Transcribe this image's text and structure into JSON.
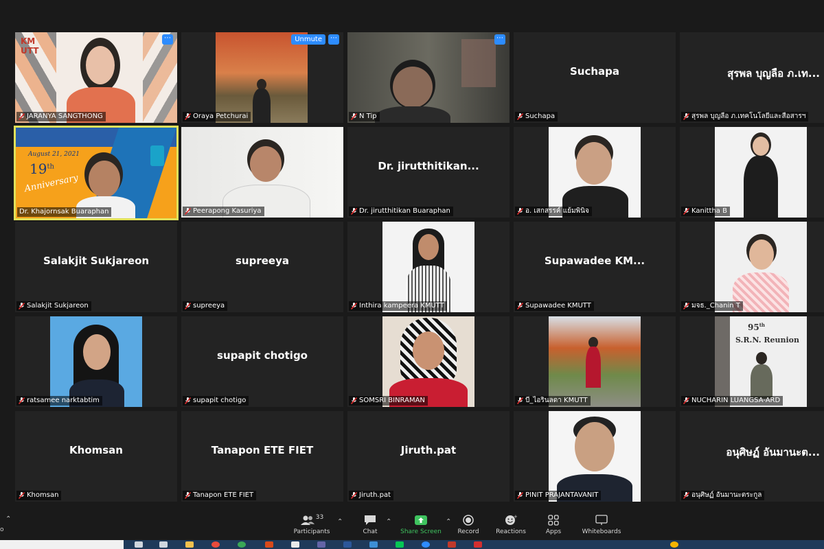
{
  "participants": [
    {
      "name": "JARANYA SANGTHONG",
      "display": "video",
      "has_more_button": true
    },
    {
      "name": "Oraya Petchurai",
      "display": "video",
      "has_more_button": true,
      "unmute_label": "Unmute"
    },
    {
      "name": "N Tip",
      "display": "video",
      "has_more_button": true
    },
    {
      "name": "Suchapa",
      "display": "name",
      "big_name": "Suchapa"
    },
    {
      "name": "สุรพล บุญลือ ภ.เทคโนโลยีและสื่อสารฯ",
      "display": "name",
      "big_name": "สุรพล บุญลือ ภ.เท..."
    },
    {
      "name": "Dr. Khajornsak Buaraphan",
      "display": "video",
      "active": true,
      "banner": {
        "date": "August 21, 2021",
        "title_num": "19",
        "title_suffix": "th",
        "title_word": "Anniversary"
      }
    },
    {
      "name": "Peerapong Kasuriya",
      "display": "video"
    },
    {
      "name": "Dr. jirutthitikan Buaraphan",
      "display": "name",
      "big_name": "Dr. jirutthitikan..."
    },
    {
      "name": "อ. เสกสรรค์ แย้มพินิจ",
      "display": "video"
    },
    {
      "name": "Kanittha B",
      "display": "video"
    },
    {
      "name": "Salakjit Sukjareon",
      "display": "name",
      "big_name": "Salakjit Sukjareon"
    },
    {
      "name": "supreeya",
      "display": "name",
      "big_name": "supreeya"
    },
    {
      "name": "Inthira kampeera  KMUTT",
      "display": "video"
    },
    {
      "name": "Supawadee KMUTT",
      "display": "name",
      "big_name": "Supawadee  KM..."
    },
    {
      "name": "มจธ._Chanin T",
      "display": "video"
    },
    {
      "name": "ratsamee narktabtim",
      "display": "video"
    },
    {
      "name": "supapit chotigo",
      "display": "name",
      "big_name": "supapit chotigo"
    },
    {
      "name": "SOMSRI BINRAMAN",
      "display": "video"
    },
    {
      "name": "บี_ไอรินลดา  KMUTT",
      "display": "video"
    },
    {
      "name": "NUCHARIN LUANGSA-ARD",
      "display": "video",
      "banner": {
        "num": "95",
        "suffix": "th",
        "title": "S.R.N. Reunion"
      }
    },
    {
      "name": "Khomsan",
      "display": "name",
      "big_name": "Khomsan"
    },
    {
      "name": "Tanapon ETE FIET",
      "display": "name",
      "big_name": "Tanapon ETE FIET"
    },
    {
      "name": "Jiruth.pat",
      "display": "name",
      "big_name": "Jiruth.pat"
    },
    {
      "name": "PINIT PRAJANTAVANIT",
      "display": "video"
    },
    {
      "name": "อนุศิษฏ์ อันมานะตระกูล",
      "display": "name",
      "big_name": "อนุศิษฏ์ อันมานะต..."
    }
  ],
  "toolbar": {
    "participants_count": "33",
    "participants_label": "Participants",
    "chat_label": "Chat",
    "share_label": "Share Screen",
    "record_label": "Record",
    "reactions_label": "Reactions",
    "apps_label": "Apps",
    "whiteboards_label": "Whiteboards",
    "left_text": "o"
  },
  "colors": {
    "accent": "#2d8cff",
    "active_speaker": "#e1e15a",
    "share_green": "#3fc35f",
    "muted_red": "#e02d2d"
  }
}
